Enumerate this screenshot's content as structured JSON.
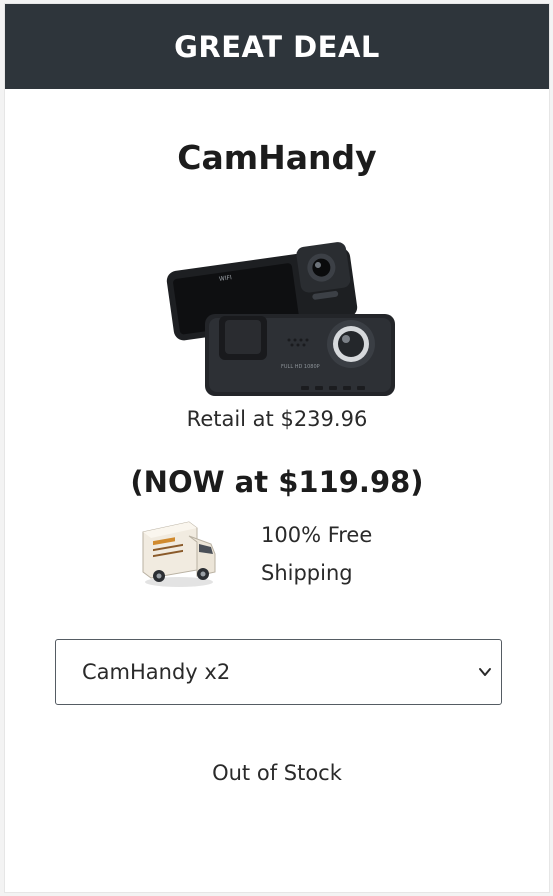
{
  "banner": {
    "title": "GREAT DEAL"
  },
  "product": {
    "name": "CamHandy",
    "image_icon": "dash-camera-image",
    "retail_label": "Retail at $239.96",
    "now_price_label": "(NOW at $119.98)"
  },
  "shipping": {
    "icon": "delivery-truck-icon",
    "line1": "100% Free",
    "line2": "Shipping"
  },
  "quantity_select": {
    "selected": "CamHandy x2",
    "icon": "chevron-down-icon"
  },
  "stock_status": "Out of Stock",
  "colors": {
    "banner_bg": "#2e353b",
    "banner_text": "#ffffff",
    "card_bg": "#ffffff",
    "text": "#1c1c1c"
  }
}
